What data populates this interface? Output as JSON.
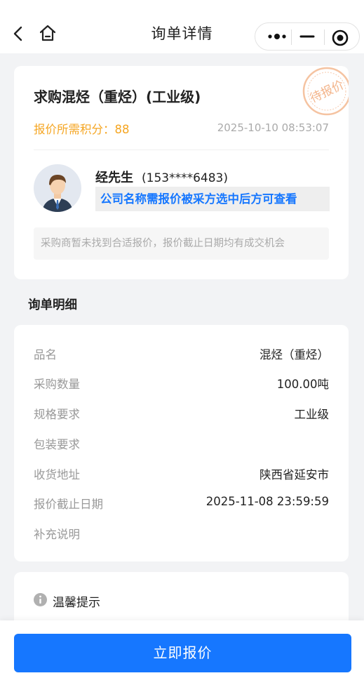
{
  "nav": {
    "title": "询单详情"
  },
  "inquiry": {
    "title": "求购混烃（重烃）(工业级)",
    "stamp_text": "待报价",
    "points_label": "报价所需积分：",
    "points_value": "88",
    "date": "2025-10-10 08:53:07",
    "contact_name": "经先生",
    "contact_phone": "(153****6483)",
    "company_tip": "公司名称需报价被采方选中后方可查看",
    "notice": "采购商暂未找到合适报价，报价截止日期均有成交机会"
  },
  "detail": {
    "section_title": "询单明细",
    "rows": [
      {
        "label": "品名",
        "value": "混烃（重烃）"
      },
      {
        "label": "采购数量",
        "value": "100.00吨"
      },
      {
        "label": "规格要求",
        "value": "工业级"
      },
      {
        "label": "包装要求",
        "value": ""
      },
      {
        "label": "收货地址",
        "value": "陕西省延安市"
      },
      {
        "label": "报价截止日期",
        "value": "2025-11-08 23:59:59"
      },
      {
        "label": "补充说明",
        "value": ""
      }
    ]
  },
  "tips": {
    "title": "温馨提示"
  },
  "actions": {
    "quote_label": "立即报价"
  },
  "colors": {
    "primary": "#1677ff",
    "points": "#f5a623",
    "stamp": "#f3b48a"
  },
  "icons": [
    "back-icon",
    "home-icon",
    "more-icon",
    "minimize-icon",
    "close-target-icon",
    "info-icon"
  ]
}
